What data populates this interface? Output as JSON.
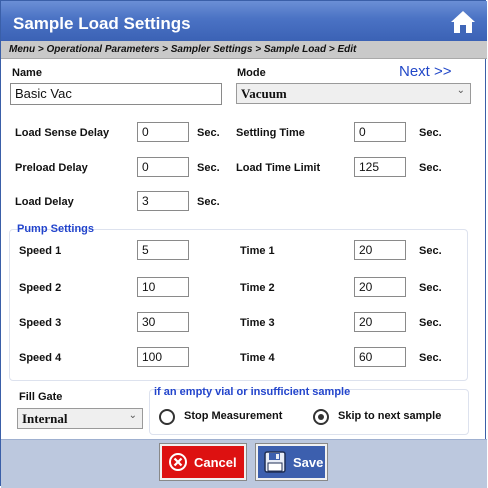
{
  "window": {
    "title": "Sample Load Settings"
  },
  "breadcrumb": "Menu > Operational Parameters > Sampler Settings > Sample Load > Edit",
  "name": {
    "label": "Name",
    "value": "Basic Vac"
  },
  "mode": {
    "label": "Mode",
    "value": "Vacuum"
  },
  "next_link": "Next >>",
  "unit": "Sec.",
  "fields": {
    "load_sense_delay": {
      "label": "Load Sense Delay",
      "value": "0"
    },
    "settling_time": {
      "label": "Settling Time",
      "value": "0"
    },
    "preload_delay": {
      "label": "Preload Delay",
      "value": "0"
    },
    "load_time_limit": {
      "label": "Load Time Limit",
      "value": "125"
    },
    "load_delay": {
      "label": "Load Delay",
      "value": "3"
    }
  },
  "pump": {
    "title": "Pump Settings",
    "speed1": {
      "label": "Speed 1",
      "value": "5"
    },
    "time1": {
      "label": "Time 1",
      "value": "20"
    },
    "speed2": {
      "label": "Speed 2",
      "value": "10"
    },
    "time2": {
      "label": "Time 2",
      "value": "20"
    },
    "speed3": {
      "label": "Speed 3",
      "value": "30"
    },
    "time3": {
      "label": "Time 3",
      "value": "20"
    },
    "speed4": {
      "label": "Speed 4",
      "value": "100"
    },
    "time4": {
      "label": "Time 4",
      "value": "60"
    }
  },
  "fill_gate": {
    "label": "Fill Gate",
    "value": "Internal"
  },
  "vial": {
    "title": "if an empty vial or insufficient sample",
    "option_stop": "Stop Measurement",
    "option_skip": "Skip to next sample",
    "selected": "option_skip"
  },
  "buttons": {
    "cancel": "Cancel",
    "save": "Save"
  },
  "colors": {
    "title_bar": "#4a72c4",
    "accent_text": "#2244cc",
    "cancel_button": "#dd1111",
    "save_button": "#3c5fae"
  },
  "icons": {
    "home": "home-icon",
    "cancel": "cancel-x-icon",
    "save": "floppy-disk-icon"
  }
}
